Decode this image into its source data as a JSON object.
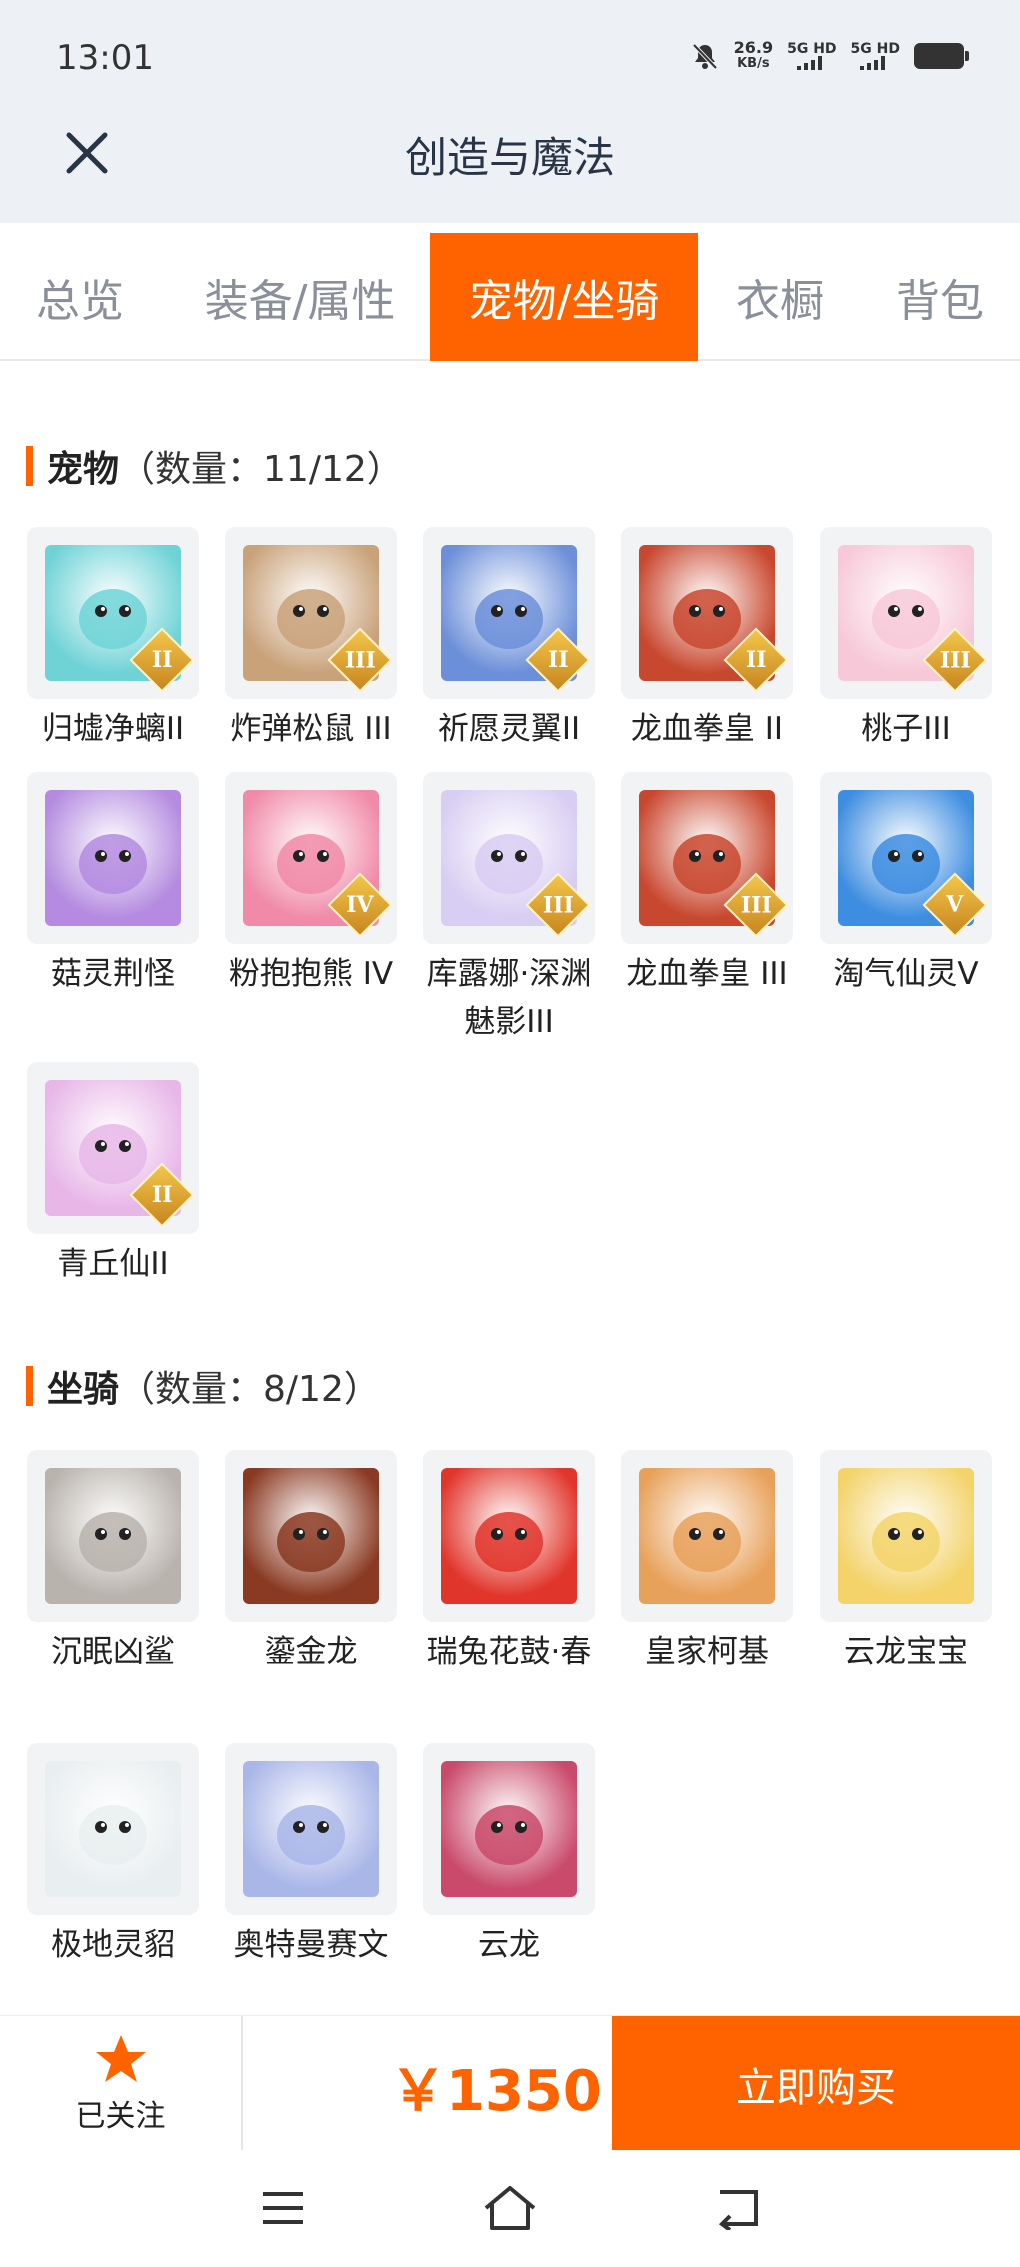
{
  "status_bar": {
    "time": "13:01",
    "speed_value": "26.9",
    "speed_unit": "KB/s",
    "net1": "5G HD",
    "net2": "5G HD"
  },
  "header": {
    "title": "创造与魔法"
  },
  "tabs": [
    {
      "label": "总览"
    },
    {
      "label": "装备/属性"
    },
    {
      "label": "宠物/坐骑",
      "active": true
    },
    {
      "label": "衣橱"
    },
    {
      "label": "背包"
    }
  ],
  "pets": {
    "title": "宠物",
    "count": "（数量：11/12）",
    "items": [
      {
        "name": "归墟净螭II",
        "badge": "II",
        "icon": "teal-dragon",
        "color": "#6fd3d6"
      },
      {
        "name": "炸弹松鼠 III",
        "badge": "III",
        "icon": "squirrel",
        "color": "#c9a27a"
      },
      {
        "name": "祈愿灵翼II",
        "badge": "II",
        "icon": "griffin",
        "color": "#6c8fd9"
      },
      {
        "name": "龙血拳皇 II",
        "badge": "II",
        "icon": "red-beast",
        "color": "#c8482f"
      },
      {
        "name": "桃子III",
        "badge": "III",
        "icon": "pink-cat",
        "color": "#f7c9d8"
      },
      {
        "name": "菇灵荆怪",
        "badge": "",
        "icon": "purple-elf",
        "color": "#b48be0"
      },
      {
        "name": "粉抱抱熊 IV",
        "badge": "IV",
        "icon": "pink-bear",
        "color": "#f08aa8"
      },
      {
        "name": "库露娜·深渊魅影III",
        "badge": "III",
        "icon": "white-spirit",
        "color": "#d8cdf2"
      },
      {
        "name": "龙血拳皇 III",
        "badge": "III",
        "icon": "red-beast",
        "color": "#c8482f"
      },
      {
        "name": "淘气仙灵V",
        "badge": "V",
        "icon": "blue-dog",
        "color": "#3d8de0"
      },
      {
        "name": "青丘仙II",
        "badge": "II",
        "icon": "fox-fairy",
        "color": "#e8b7e8"
      }
    ]
  },
  "mounts": {
    "title": "坐骑",
    "count": "（数量：8/12）",
    "items": [
      {
        "name": "沉眠凶鲨",
        "icon": "shark",
        "color": "#b9b3ad"
      },
      {
        "name": "鎏金龙",
        "icon": "gold-dragon",
        "color": "#8a3a22"
      },
      {
        "name": "瑞兔花鼓·春",
        "icon": "rabbit-drum",
        "color": "#e0352b"
      },
      {
        "name": "皇家柯基",
        "icon": "corgi",
        "color": "#e8a15a"
      },
      {
        "name": "云龙宝宝",
        "icon": "baby-dragon",
        "color": "#f3d36a"
      },
      {
        "name": "极地灵貂",
        "icon": "white-fox",
        "color": "#e9eef0"
      },
      {
        "name": "奥特曼赛文",
        "icon": "ultraman",
        "color": "#a9b6e8"
      },
      {
        "name": "云龙",
        "icon": "cloud-dragon",
        "color": "#c94a6a"
      }
    ]
  },
  "footer": {
    "follow_label": "已关注",
    "price": "￥1350",
    "buy_label": "立即购买"
  },
  "accent_color": "#ff6300"
}
